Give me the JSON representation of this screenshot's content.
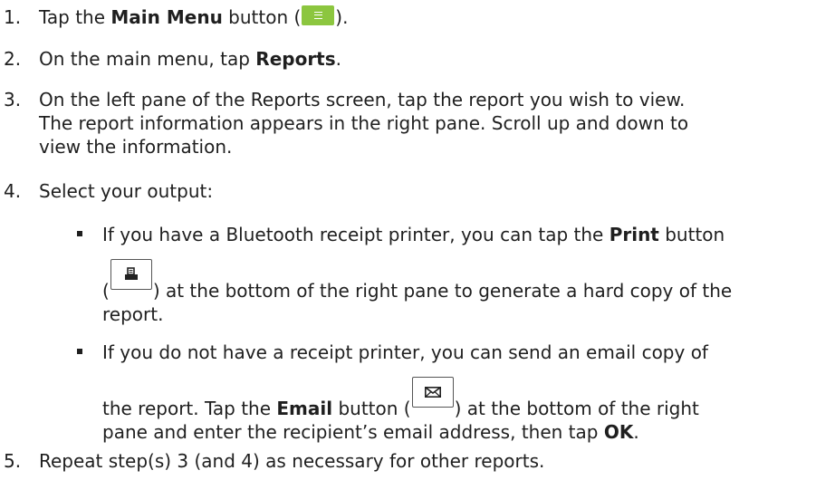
{
  "steps": [
    {
      "num": "1.",
      "pre": "Tap the ",
      "bold": "Main Menu",
      "mid": " button (",
      "post": ")."
    },
    {
      "num": "2.",
      "pre": "On the main menu, tap ",
      "bold": "Reports",
      "post": "."
    },
    {
      "num": "3.",
      "lines": [
        "On the left pane of the Reports screen, tap the report you wish to view.",
        "The report information appears in the right pane. Scroll up and down to",
        "view the information."
      ]
    },
    {
      "num": "4.",
      "text": "Select your output:"
    },
    {
      "num": "5.",
      "text": "Repeat step(s) 3 (and 4) as necessary for other reports."
    }
  ],
  "bullets": {
    "print": {
      "line1_pre": "If you have a Bluetooth receipt printer, you can tap the ",
      "line1_bold": "Print",
      "line1_post": " button",
      "line2_pre": "(",
      "line2_post": ") at the bottom of the right pane to generate a hard copy of the",
      "line3": "report."
    },
    "email": {
      "line1": "If you do not have a receipt printer, you can send an email copy of",
      "line2_pre": "the report. Tap the ",
      "line2_bold": "Email",
      "line2_mid": " button (",
      "line2_post": ") at the bottom of the right",
      "line3_pre": "pane and enter the recipient’s email address, then tap ",
      "line3_bold": "OK",
      "line3_post": "."
    }
  },
  "icons": {
    "menu_button_color": "#8cc63f",
    "menu_icon": "hamburger-icon",
    "print_icon": "printer-icon",
    "email_icon": "envelope-icon"
  }
}
